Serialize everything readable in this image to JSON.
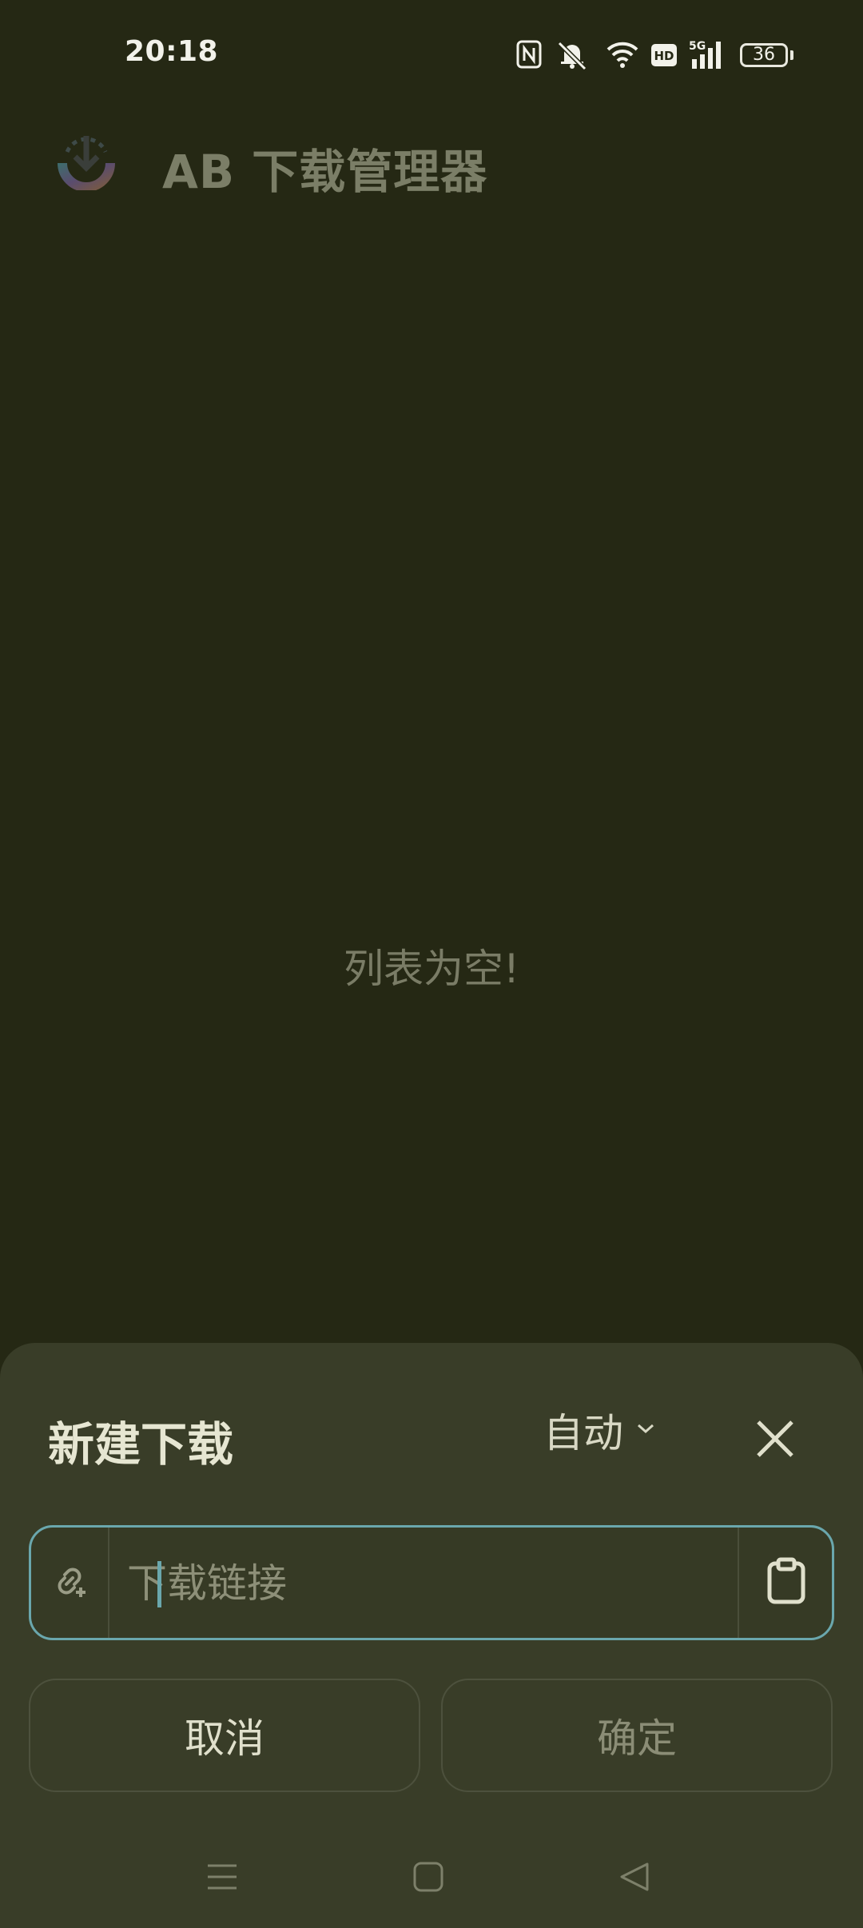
{
  "status_bar": {
    "time": "20:18",
    "icons": [
      "nfc-icon",
      "mute-bell-icon",
      "wifi-icon",
      "hd-icon",
      "5g-signal-icon",
      "battery-icon"
    ],
    "battery_level": "36"
  },
  "app": {
    "title": "AB 下载管理器",
    "logo": "download-logo-icon"
  },
  "main": {
    "empty_message": "列表为空!"
  },
  "new_download_sheet": {
    "title": "新建下载",
    "mode": "自动",
    "url_input": {
      "value": "",
      "placeholder": "下载链接"
    },
    "cancel_label": "取消",
    "confirm_label": "确定"
  },
  "colors": {
    "background": "#252814",
    "sheet": "#393d28",
    "accent": "#6aa7ad"
  },
  "nav_bar": [
    "menu-icon",
    "home-icon",
    "back-icon"
  ]
}
